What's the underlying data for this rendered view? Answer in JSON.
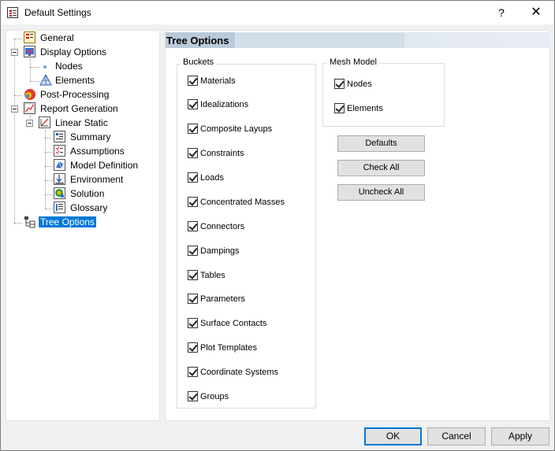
{
  "window": {
    "title": "Default Settings",
    "help_label": "?",
    "close_label": "✕"
  },
  "tree": {
    "items": [
      {
        "label": "General",
        "icon": "general-settings-icon"
      },
      {
        "label": "Display Options",
        "icon": "display-options-icon"
      },
      {
        "label": "Nodes",
        "icon": "node-dot-icon"
      },
      {
        "label": "Elements",
        "icon": "element-mesh-icon"
      },
      {
        "label": "Post-Processing",
        "icon": "post-processing-icon"
      },
      {
        "label": "Report Generation",
        "icon": "report-generation-icon"
      },
      {
        "label": "Linear Static",
        "icon": "linear-static-icon"
      },
      {
        "label": "Summary",
        "icon": "summary-icon"
      },
      {
        "label": "Assumptions",
        "icon": "assumptions-icon"
      },
      {
        "label": "Model Definition",
        "icon": "model-definition-icon"
      },
      {
        "label": "Environment",
        "icon": "environment-icon"
      },
      {
        "label": "Solution",
        "icon": "solution-icon"
      },
      {
        "label": "Glossary",
        "icon": "glossary-icon"
      },
      {
        "label": "Tree Options",
        "icon": "tree-options-icon",
        "selected": true
      }
    ]
  },
  "panel": {
    "title": "Tree Options",
    "buckets": {
      "legend": "Buckets",
      "items": [
        {
          "label": "Materials",
          "checked": true
        },
        {
          "label": "Idealizations",
          "checked": true
        },
        {
          "label": "Composite Layups",
          "checked": true
        },
        {
          "label": "Constraints",
          "checked": true
        },
        {
          "label": "Loads",
          "checked": true
        },
        {
          "label": "Concentrated Masses",
          "checked": true
        },
        {
          "label": "Connectors",
          "checked": true
        },
        {
          "label": "Dampings",
          "checked": true
        },
        {
          "label": "Tables",
          "checked": true
        },
        {
          "label": "Parameters",
          "checked": true
        },
        {
          "label": "Surface Contacts",
          "checked": true
        },
        {
          "label": "Plot Templates",
          "checked": true
        },
        {
          "label": "Coordinate Systems",
          "checked": true
        },
        {
          "label": "Groups",
          "checked": true
        }
      ]
    },
    "mesh_model": {
      "legend": "Mesh Model",
      "items": [
        {
          "label": "Nodes",
          "checked": true
        },
        {
          "label": "Elements",
          "checked": true
        }
      ]
    },
    "buttons": {
      "defaults": "Defaults",
      "check_all": "Check All",
      "uncheck_all": "Uncheck All"
    }
  },
  "footer": {
    "ok": "OK",
    "cancel": "Cancel",
    "apply": "Apply"
  },
  "colors": {
    "selection": "#0078d7",
    "header_tab": "#b9cad9",
    "button_face": "#e1e1e1"
  }
}
